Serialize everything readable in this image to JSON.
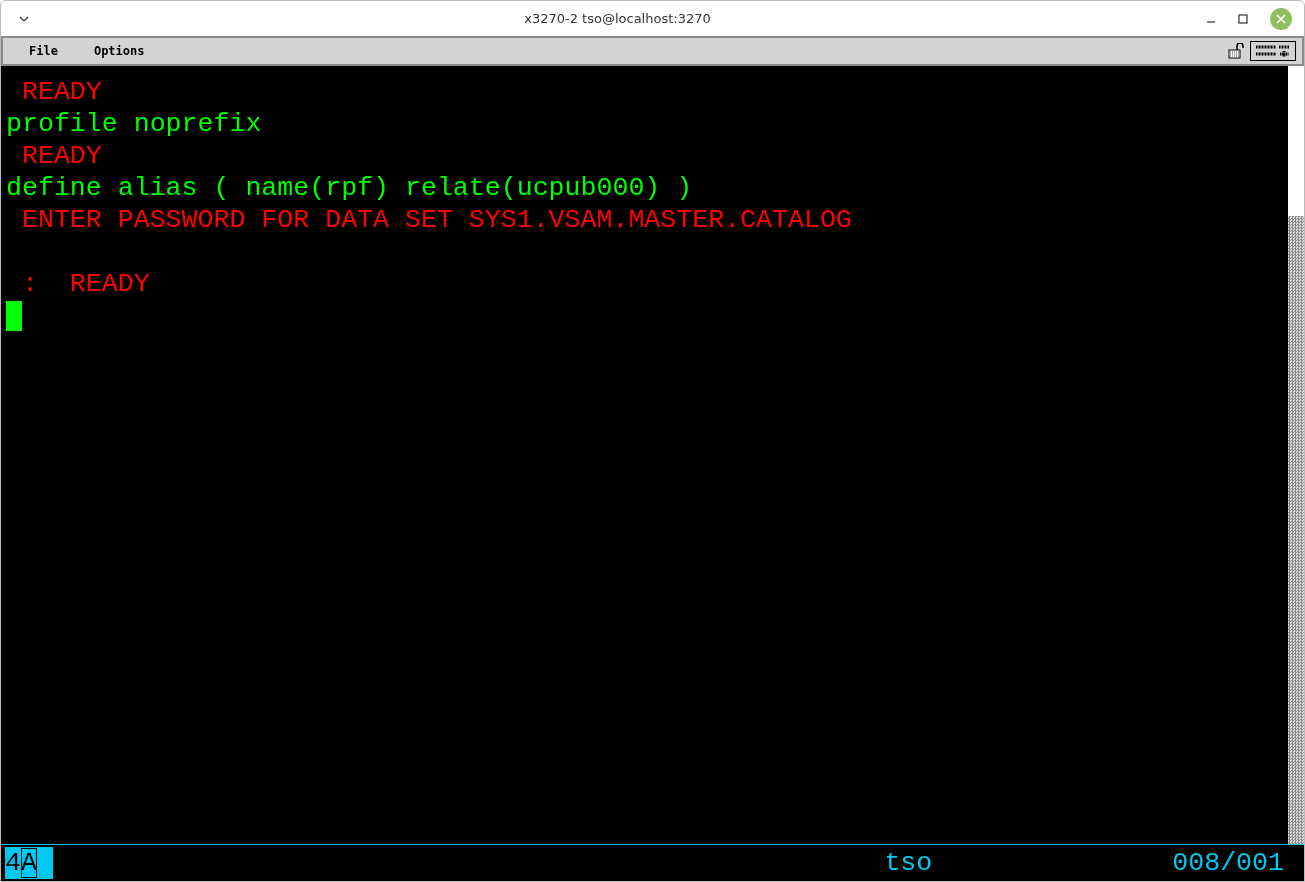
{
  "window": {
    "title": "x3270-2 tso@localhost:3270"
  },
  "menu": [
    "File",
    "Options"
  ],
  "screen": {
    "lines": [
      {
        "kind": "output",
        "text": " READY"
      },
      {
        "kind": "input",
        "text": "profile noprefix"
      },
      {
        "kind": "output",
        "text": " READY"
      },
      {
        "kind": "input",
        "text": "define alias ( name(rpf) relate(ucpub000) )"
      },
      {
        "kind": "output",
        "text": " ENTER PASSWORD FOR DATA SET SYS1.VSAM.MASTER.CATALOG"
      },
      {
        "kind": "blank"
      },
      {
        "kind": "output",
        "text": " :  READY"
      }
    ]
  },
  "status_bar": {
    "indicator": [
      "4",
      "A"
    ],
    "host": "tso",
    "cursor_position": "008/001"
  }
}
